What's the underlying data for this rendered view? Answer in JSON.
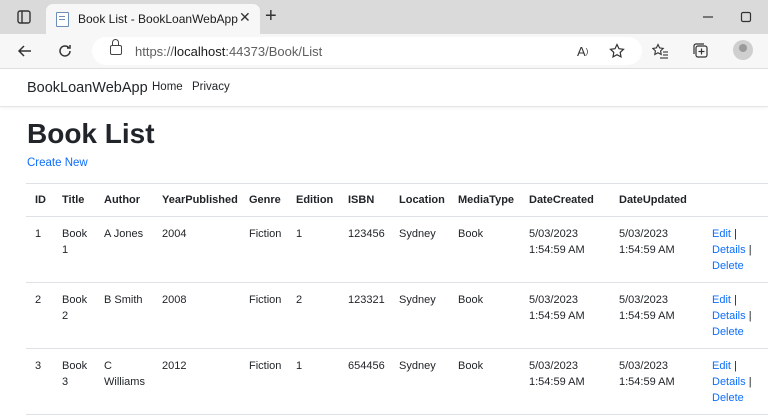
{
  "browser": {
    "tab_title": "Book List - BookLoanWebApp",
    "url_prefix": "https://",
    "url_host": "localhost",
    "url_rest": ":44373/Book/List"
  },
  "site": {
    "brand": "BookLoanWebApp",
    "nav": [
      "Home",
      "Privacy"
    ]
  },
  "page": {
    "title": "Book List",
    "create_label": "Create New"
  },
  "table": {
    "headers": [
      "ID",
      "Title",
      "Author",
      "YearPublished",
      "Genre",
      "Edition",
      "ISBN",
      "Location",
      "MediaType",
      "DateCreated",
      "DateUpdated",
      ""
    ],
    "rows": [
      {
        "id": "1",
        "title": "Book 1",
        "author": "A Jones",
        "year": "2004",
        "genre": "Fiction",
        "edition": "1",
        "isbn": "123456",
        "location": "Sydney",
        "media": "Book",
        "created": "5/03/2023 1:54:59 AM",
        "updated": "5/03/2023 1:54:59 AM"
      },
      {
        "id": "2",
        "title": "Book 2",
        "author": "B Smith",
        "year": "2008",
        "genre": "Fiction",
        "edition": "2",
        "isbn": "123321",
        "location": "Sydney",
        "media": "Book",
        "created": "5/03/2023 1:54:59 AM",
        "updated": "5/03/2023 1:54:59 AM"
      },
      {
        "id": "3",
        "title": "Book 3",
        "author": "C Williams",
        "year": "2012",
        "genre": "Fiction",
        "edition": "1",
        "isbn": "654456",
        "location": "Sydney",
        "media": "Book",
        "created": "5/03/2023 1:54:59 AM",
        "updated": "5/03/2023 1:54:59 AM"
      }
    ],
    "actions": {
      "edit": "Edit",
      "details": "Details",
      "delete": "Delete",
      "separator": "|"
    }
  },
  "colors": {
    "link": "#0d6efd",
    "text": "#212529",
    "chrome": "#dadada"
  }
}
